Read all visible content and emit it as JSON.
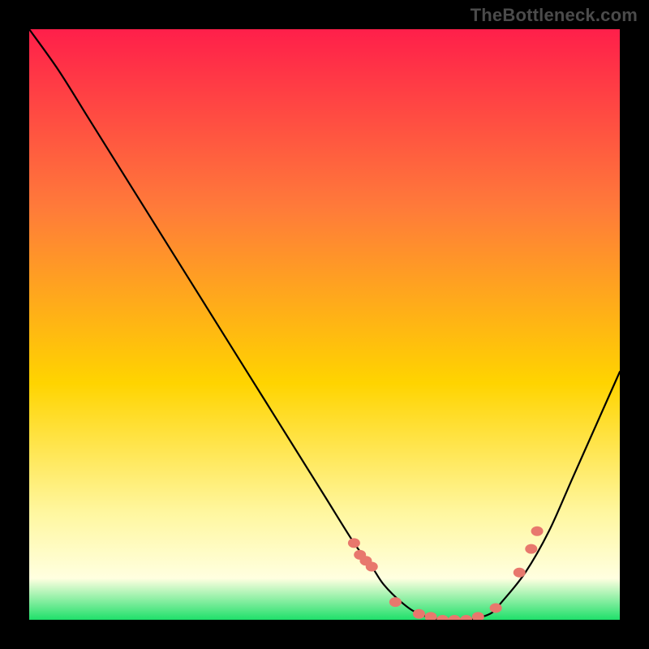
{
  "watermark": "TheBottleneck.com",
  "colors": {
    "gradient_top": "#ff1f4a",
    "gradient_mid_upper": "#ff7a3a",
    "gradient_mid": "#ffd400",
    "gradient_pale": "#fff7a0",
    "gradient_green": "#1fe06a",
    "curve": "#000000",
    "dot": "#e8786d",
    "background": "#000000"
  },
  "chart_data": {
    "type": "line",
    "title": "",
    "xlabel": "",
    "ylabel": "",
    "xlim": [
      0,
      100
    ],
    "ylim": [
      0,
      100
    ],
    "series": [
      {
        "name": "bottleneck-curve",
        "x": [
          0,
          5,
          10,
          15,
          20,
          25,
          30,
          35,
          40,
          45,
          50,
          55,
          58,
          60,
          63,
          66,
          70,
          74,
          78,
          80,
          84,
          88,
          92,
          96,
          100
        ],
        "y": [
          100,
          93,
          85,
          77,
          69,
          61,
          53,
          45,
          37,
          29,
          21,
          13,
          9,
          6,
          3,
          1,
          0,
          0,
          1,
          3,
          8,
          15,
          24,
          33,
          42
        ]
      }
    ],
    "points": {
      "name": "highlight-dots",
      "x": [
        55,
        56,
        57,
        58,
        62,
        66,
        68,
        70,
        72,
        74,
        76,
        79,
        83,
        85,
        86
      ],
      "y": [
        13,
        11,
        10,
        9,
        3,
        1,
        0.5,
        0,
        0,
        0,
        0.5,
        2,
        8,
        12,
        15
      ]
    },
    "gradient_stops": [
      {
        "offset": 0.0,
        "color": "#ff1f4a"
      },
      {
        "offset": 0.3,
        "color": "#ff7a3a"
      },
      {
        "offset": 0.6,
        "color": "#ffd400"
      },
      {
        "offset": 0.82,
        "color": "#fff7a0"
      },
      {
        "offset": 0.93,
        "color": "#ffffe0"
      },
      {
        "offset": 1.0,
        "color": "#1fe06a"
      }
    ]
  }
}
